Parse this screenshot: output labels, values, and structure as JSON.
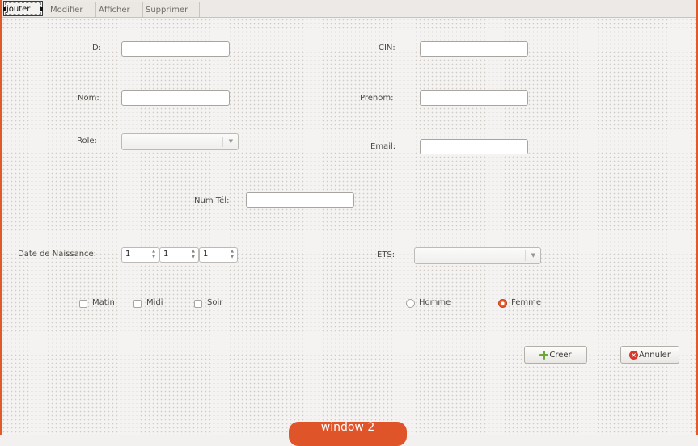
{
  "tabs": [
    {
      "label": "Ajouter",
      "active": true
    },
    {
      "label": "Modifier",
      "active": false
    },
    {
      "label": "Afficher",
      "active": false
    },
    {
      "label": "Supprimer",
      "active": false
    }
  ],
  "visible_tab_text": "jouter",
  "form": {
    "id_label": "ID:",
    "cin_label": "CIN:",
    "nom_label": "Nom:",
    "prenom_label": "Prenom:",
    "role_label": "Role:",
    "email_label": "Email:",
    "numtel_label": "Num Tél:",
    "date_label": "Date de Naissance:",
    "ets_label": "ETS:",
    "date_day": "1",
    "date_month": "1",
    "date_year": "1",
    "fields": {
      "id": "",
      "cin": "",
      "nom": "",
      "prenom": "",
      "email": "",
      "numtel": ""
    },
    "role_selected": "",
    "ets_selected": ""
  },
  "shifts": [
    {
      "label": "Matin",
      "checked": false
    },
    {
      "label": "Midi",
      "checked": false
    },
    {
      "label": "Soir",
      "checked": false
    }
  ],
  "gender": [
    {
      "label": "Homme",
      "selected": false
    },
    {
      "label": "Femme",
      "selected": true
    }
  ],
  "buttons": {
    "create": "Créer",
    "cancel": "Annuler"
  },
  "bottom_pill": "window 2",
  "colors": {
    "accent": "#e0592a",
    "plus_icon": "#6aa837",
    "cancel_icon": "#d9382a"
  }
}
